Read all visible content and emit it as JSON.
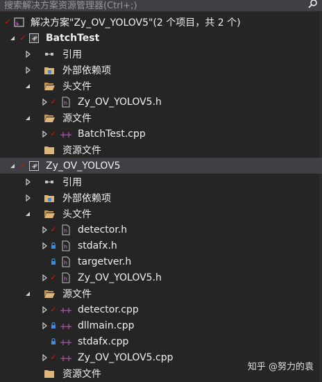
{
  "search": {
    "placeholder": "搜索解决方案资源管理器(Ctrl+;)",
    "icon": "search-icon"
  },
  "solution": {
    "label": "解决方案\"Zy_OV_YOLOV5\"(2 个项目，共 2 个)"
  },
  "projects": [
    {
      "name": "BatchTest",
      "references": "引用",
      "external": "外部依赖项",
      "headers_label": "头文件",
      "headers": [
        {
          "name": "Zy_OV_YOLOV5.h",
          "state": "check"
        }
      ],
      "sources_label": "源文件",
      "sources": [
        {
          "name": "BatchTest.cpp",
          "state": "check"
        }
      ],
      "resources": "资源文件"
    },
    {
      "name": "Zy_OV_YOLOV5",
      "references": "引用",
      "external": "外部依赖项",
      "headers_label": "头文件",
      "headers": [
        {
          "name": "detector.h",
          "state": "check"
        },
        {
          "name": "stdafx.h",
          "state": "lock"
        },
        {
          "name": "targetver.h",
          "state": "lock"
        },
        {
          "name": "Zy_OV_YOLOV5.h",
          "state": "check"
        }
      ],
      "sources_label": "源文件",
      "sources": [
        {
          "name": "detector.cpp",
          "state": "check"
        },
        {
          "name": "dllmain.cpp",
          "state": "lock"
        },
        {
          "name": "stdafx.cpp",
          "state": "lock"
        },
        {
          "name": "Zy_OV_YOLOV5.cpp",
          "state": "check"
        }
      ],
      "resources": "资源文件"
    }
  ],
  "watermark": "知乎 @努力的袁",
  "colors": {
    "background": "#252526",
    "selection": "#3f3f46",
    "check": "#e51400",
    "lock": "#3c8de0",
    "folder": "#dcb67a",
    "cpp": "#9b4f96"
  }
}
